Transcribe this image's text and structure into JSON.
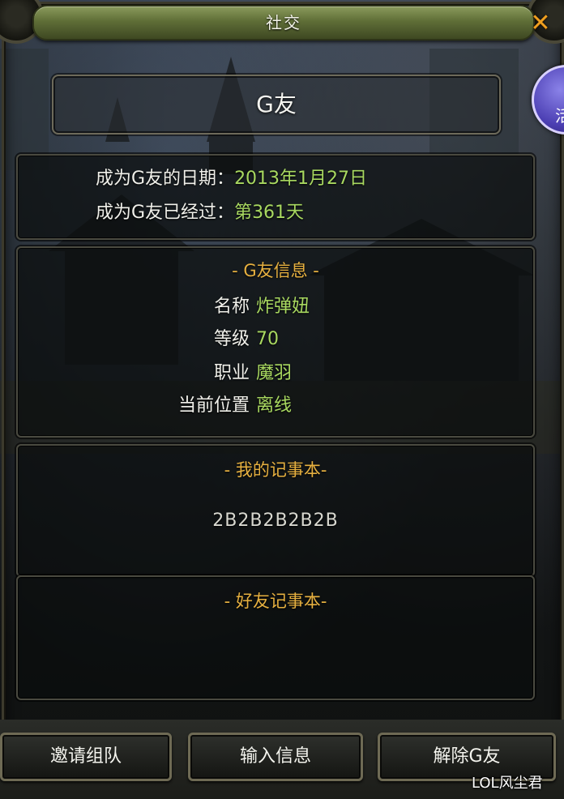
{
  "window": {
    "title": "社交"
  },
  "side_orb": {
    "text": "活"
  },
  "friend": {
    "name": "G友"
  },
  "relationship": {
    "date_label": "成为G友的日期：",
    "date_value": "2013年1月27日",
    "elapsed_label": "成为G友已经过：",
    "elapsed_value": "第361天"
  },
  "info": {
    "title": "- G友信息 -",
    "fields": [
      {
        "label": "名称",
        "value": "炸弹妞"
      },
      {
        "label": "等级",
        "value": "70"
      },
      {
        "label": "职业",
        "value": "魔羽"
      },
      {
        "label": "当前位置",
        "value": "离线"
      }
    ]
  },
  "my_notebook": {
    "title": "- 我的记事本-",
    "content": "2B2B2B2B2B"
  },
  "friend_notebook": {
    "title": "- 好友记事本-",
    "content": ""
  },
  "buttons": {
    "invite": "邀请组队",
    "message": "输入信息",
    "remove": "解除G友"
  },
  "watermark": "LOL风尘君",
  "colors": {
    "label": "#f0f0ea",
    "value": "#a8d860",
    "section_title": "#e6b040",
    "title_bar": "#5f6e37",
    "close": "#f0a020"
  }
}
